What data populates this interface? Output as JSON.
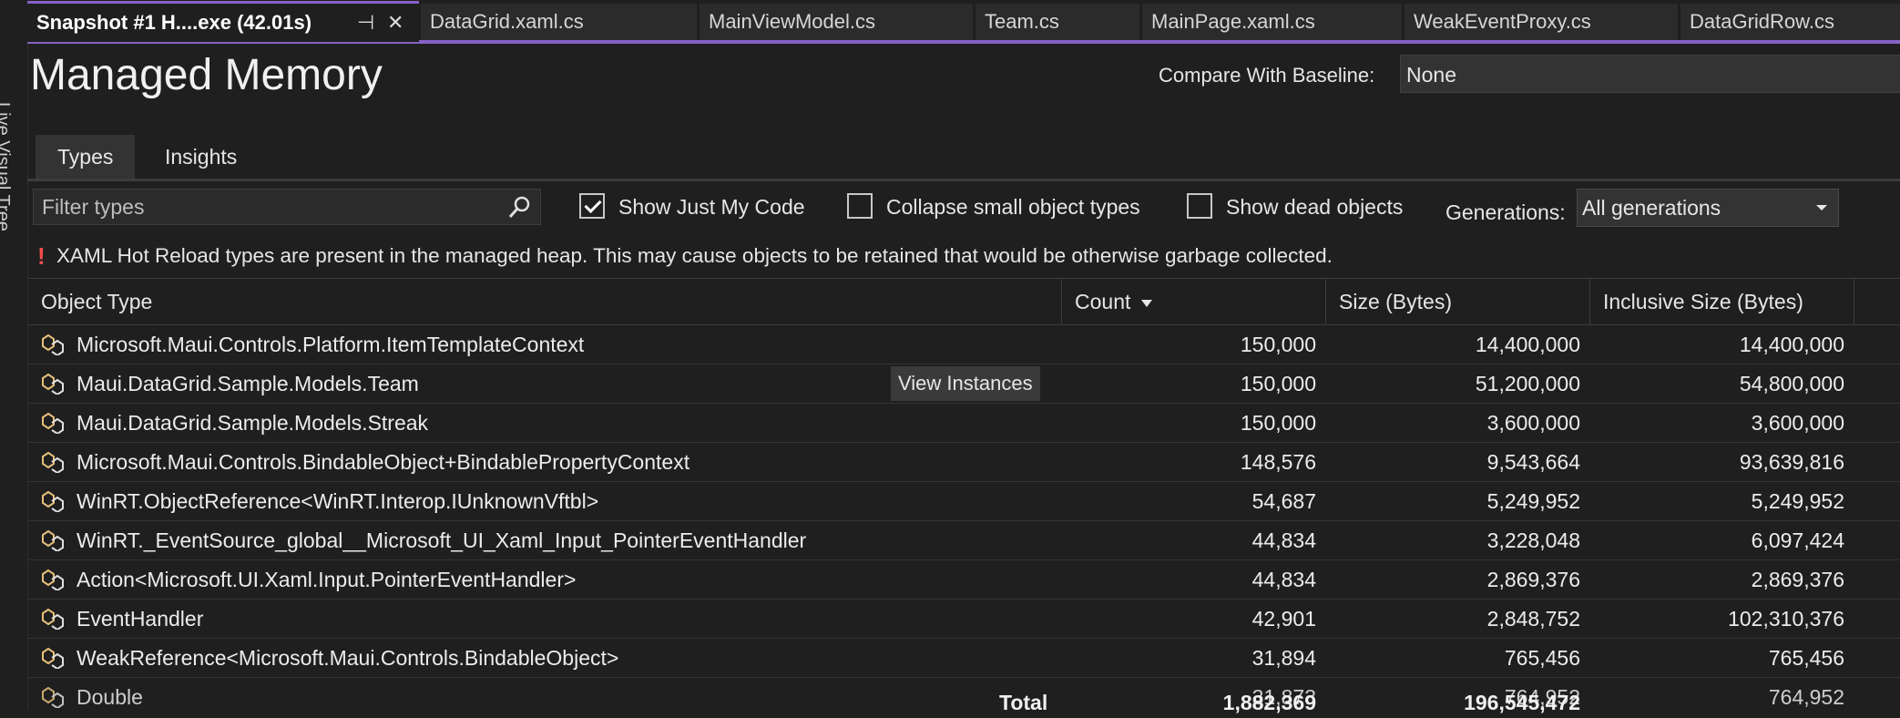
{
  "side_panel": {
    "label": "Live Visual Tree"
  },
  "tabs": [
    {
      "label": "Snapshot #1 H....exe (42.01s)",
      "active": true
    },
    {
      "label": "DataGrid.xaml.cs"
    },
    {
      "label": "MainViewModel.cs"
    },
    {
      "label": "Team.cs"
    },
    {
      "label": "MainPage.xaml.cs"
    },
    {
      "label": "WeakEventProxy.cs"
    },
    {
      "label": "DataGridRow.cs"
    }
  ],
  "header": {
    "title": "Managed Memory",
    "baseline_label": "Compare With Baseline:",
    "baseline_value": "None"
  },
  "subtabs": [
    {
      "label": "Types",
      "active": true
    },
    {
      "label": "Insights"
    }
  ],
  "toolbar": {
    "filter_placeholder": "Filter types",
    "show_just_my_code": {
      "label": "Show Just My Code",
      "checked": true
    },
    "collapse_small": {
      "label": "Collapse small object types",
      "checked": false
    },
    "show_dead": {
      "label": "Show dead objects",
      "checked": false
    },
    "generations_label": "Generations:",
    "generations_value": "All generations"
  },
  "warning": {
    "icon": "!",
    "text": "XAML Hot Reload types are present in the managed heap. This may cause objects to be retained that would be otherwise garbage collected."
  },
  "table": {
    "columns": [
      "Object Type",
      "Count",
      "Size (Bytes)",
      "Inclusive Size (Bytes)"
    ],
    "sort_column": "Count",
    "rows": [
      {
        "type": "Microsoft.Maui.Controls.Platform.ItemTemplateContext",
        "count": "150,000",
        "size": "14,400,000",
        "inclusive": "14,400,000"
      },
      {
        "type": "Maui.DataGrid.Sample.Models.Team",
        "count": "150,000",
        "size": "51,200,000",
        "inclusive": "54,800,000",
        "action": "View Instances"
      },
      {
        "type": "Maui.DataGrid.Sample.Models.Streak",
        "count": "150,000",
        "size": "3,600,000",
        "inclusive": "3,600,000"
      },
      {
        "type": "Microsoft.Maui.Controls.BindableObject+BindablePropertyContext",
        "count": "148,576",
        "size": "9,543,664",
        "inclusive": "93,639,816"
      },
      {
        "type": "WinRT.ObjectReference<WinRT.Interop.IUnknownVftbl>",
        "count": "54,687",
        "size": "5,249,952",
        "inclusive": "5,249,952"
      },
      {
        "type": "WinRT._EventSource_global__Microsoft_UI_Xaml_Input_PointerEventHandler",
        "count": "44,834",
        "size": "3,228,048",
        "inclusive": "6,097,424"
      },
      {
        "type": "Action<Microsoft.UI.Xaml.Input.PointerEventHandler>",
        "count": "44,834",
        "size": "2,869,376",
        "inclusive": "2,869,376"
      },
      {
        "type": "EventHandler",
        "count": "42,901",
        "size": "2,848,752",
        "inclusive": "102,310,376"
      },
      {
        "type": "WeakReference<Microsoft.Maui.Controls.BindableObject>",
        "count": "31,894",
        "size": "765,456",
        "inclusive": "765,456"
      },
      {
        "type": "Double",
        "count": "31,873",
        "size": "764,952",
        "inclusive": "764,952"
      }
    ],
    "total": {
      "label": "Total",
      "count": "1,882,369",
      "size": "196,545,472"
    }
  }
}
